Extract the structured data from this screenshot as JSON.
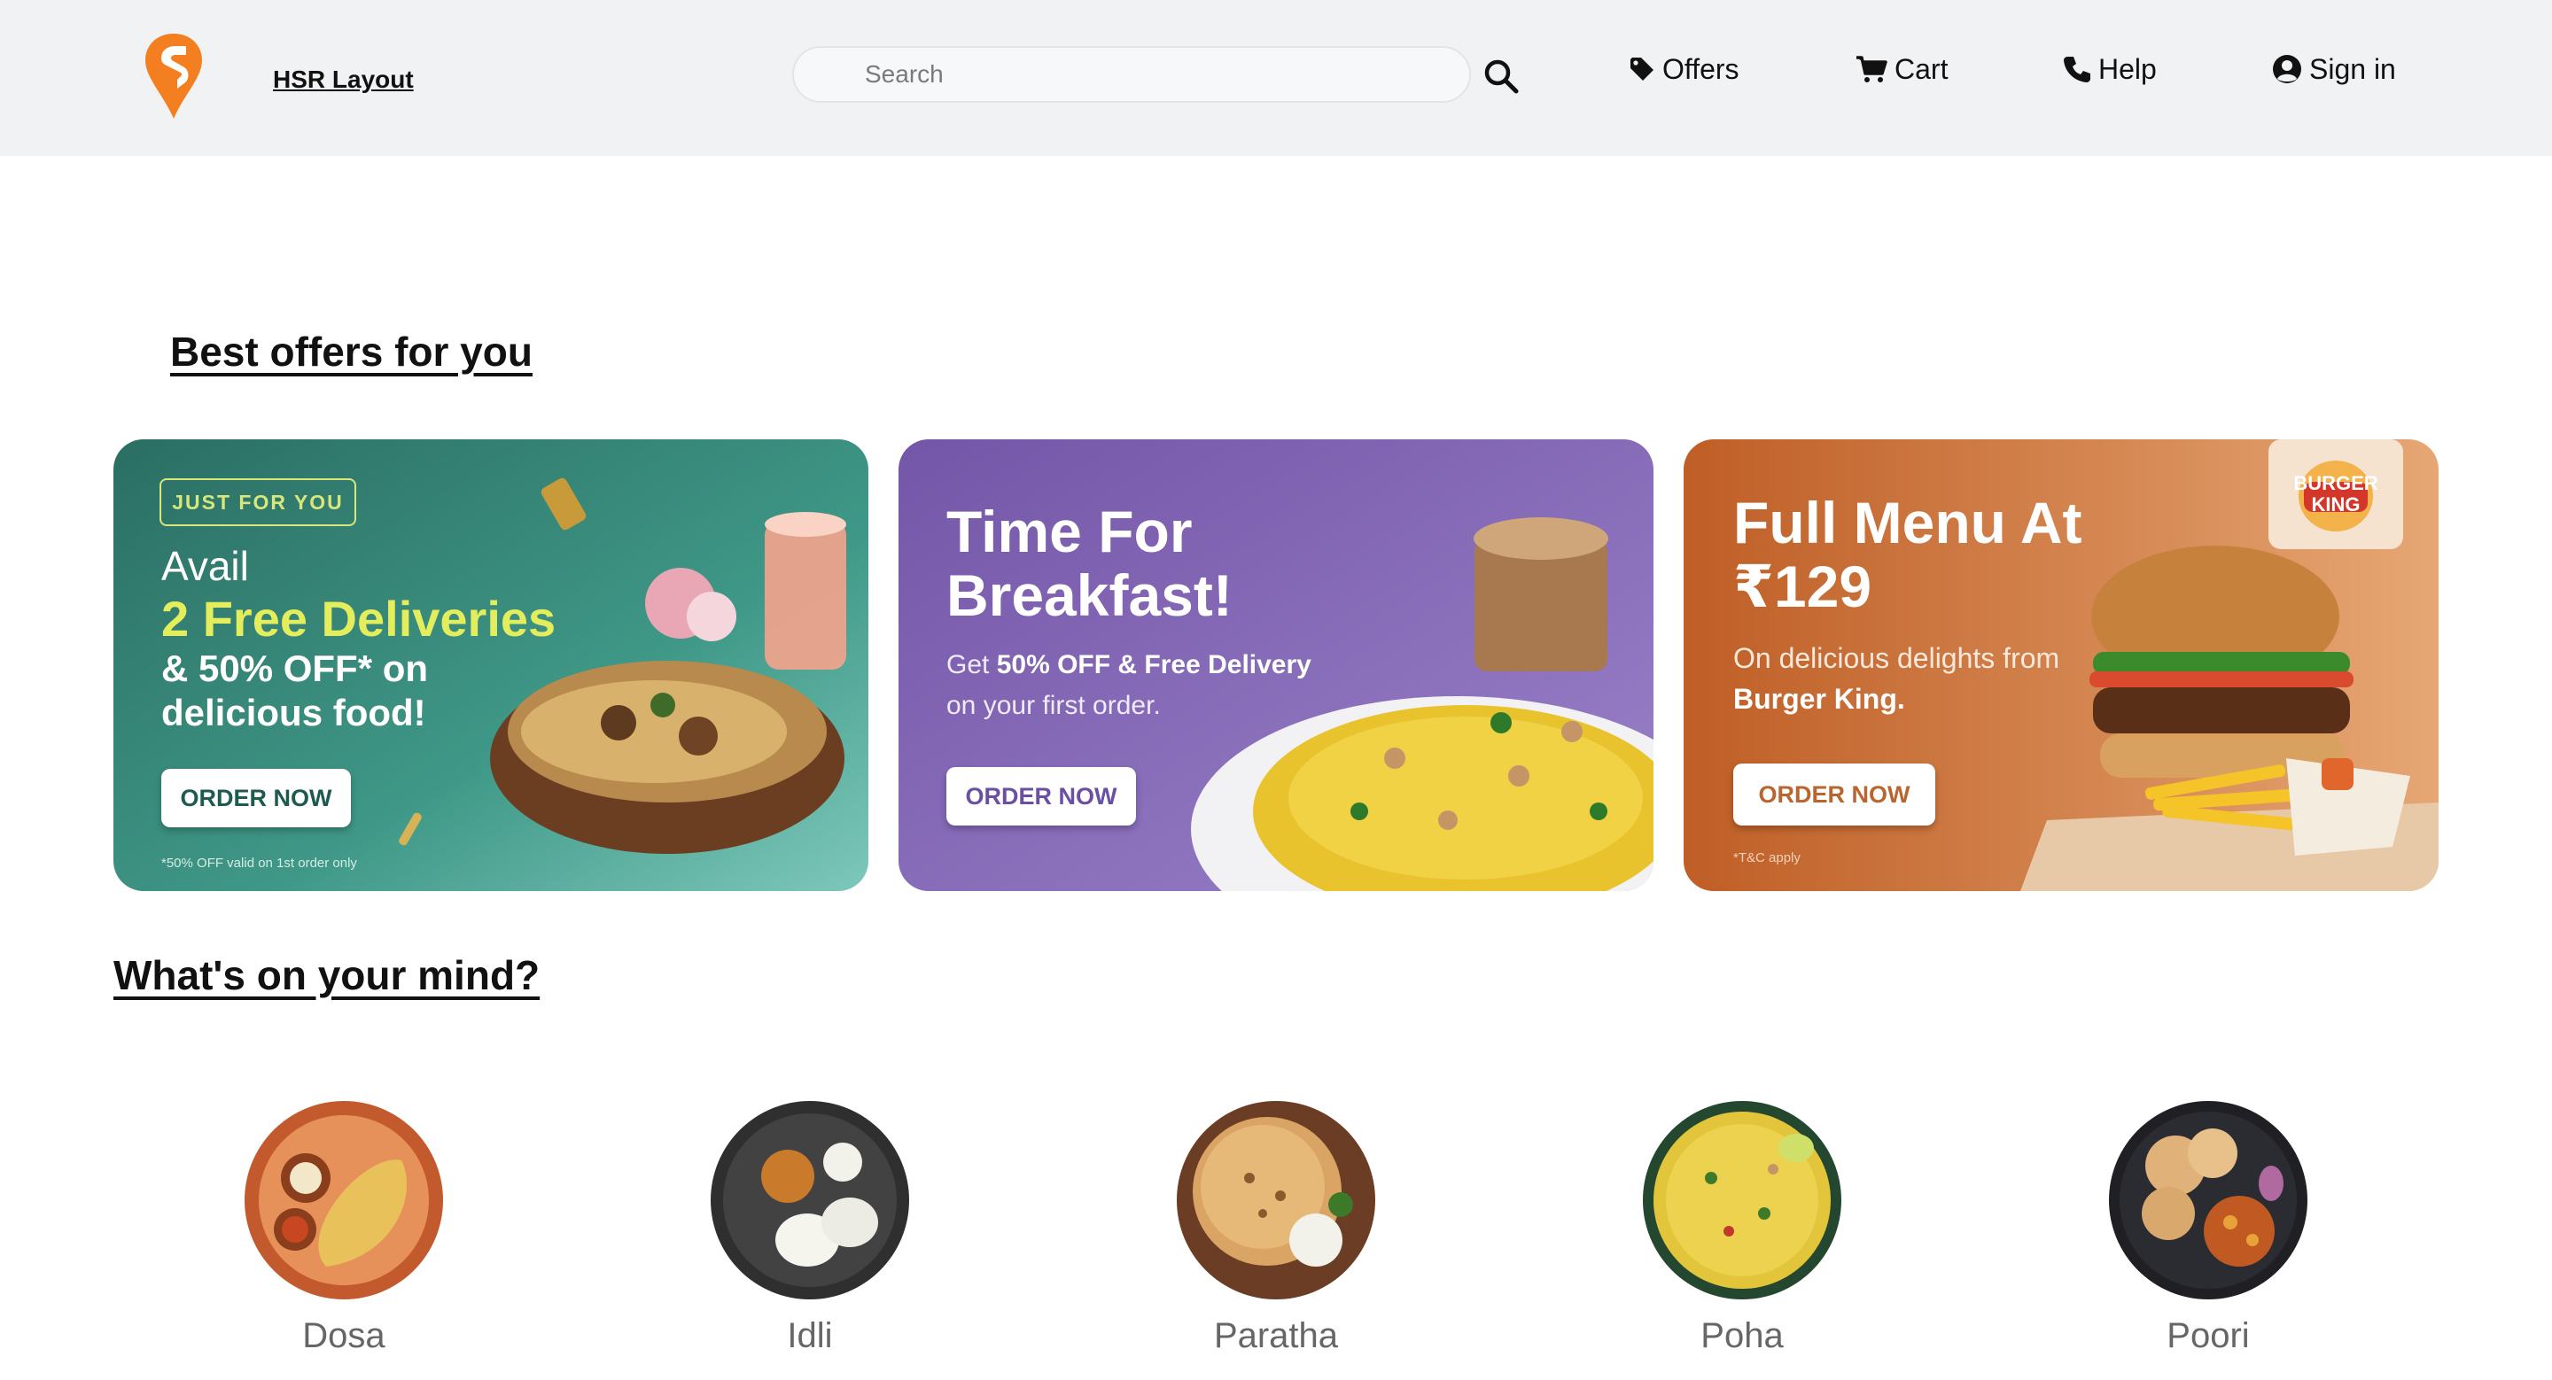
{
  "header": {
    "location": "HSR Layout",
    "search_placeholder": "Search",
    "nav": [
      {
        "label": "Offers",
        "icon": "tag-icon"
      },
      {
        "label": "Cart",
        "icon": "cart-icon"
      },
      {
        "label": "Help",
        "icon": "phone-icon"
      },
      {
        "label": "Sign in",
        "icon": "user-circle-icon"
      }
    ]
  },
  "colors": {
    "brand_orange": "#f47f20",
    "header_bg": "#f1f2f4",
    "card1_bg": "#2d7d71",
    "card2_bg": "#7c5fb0",
    "card3_bg": "#c8743c",
    "highlight_yellow": "#e4ee5c"
  },
  "offers": {
    "title": "Best offers for you",
    "cards": [
      {
        "badge": "JUST FOR YOU",
        "line1": "Avail",
        "highlight": "2 Free Deliveries",
        "line2": "& 50% OFF* on delicious food!",
        "button": "ORDER NOW",
        "note": "*50% OFF valid on 1st order only"
      },
      {
        "title": "Time For Breakfast!",
        "sub_prefix": "Get ",
        "sub_bold1": "50% OFF & Free Delivery",
        "sub_suffix": " on your first order.",
        "button": "ORDER NOW"
      },
      {
        "title": "Full Menu At ₹129",
        "sub_prefix": "On delicious delights from ",
        "sub_bold": "Burger King.",
        "button": "ORDER NOW",
        "note": "*T&C apply",
        "brand_logo_text": "BURGER KING"
      }
    ]
  },
  "mind": {
    "title": "What's on your mind?",
    "items": [
      {
        "label": "Dosa"
      },
      {
        "label": "Idli"
      },
      {
        "label": "Paratha"
      },
      {
        "label": "Poha"
      },
      {
        "label": "Poori"
      }
    ]
  }
}
